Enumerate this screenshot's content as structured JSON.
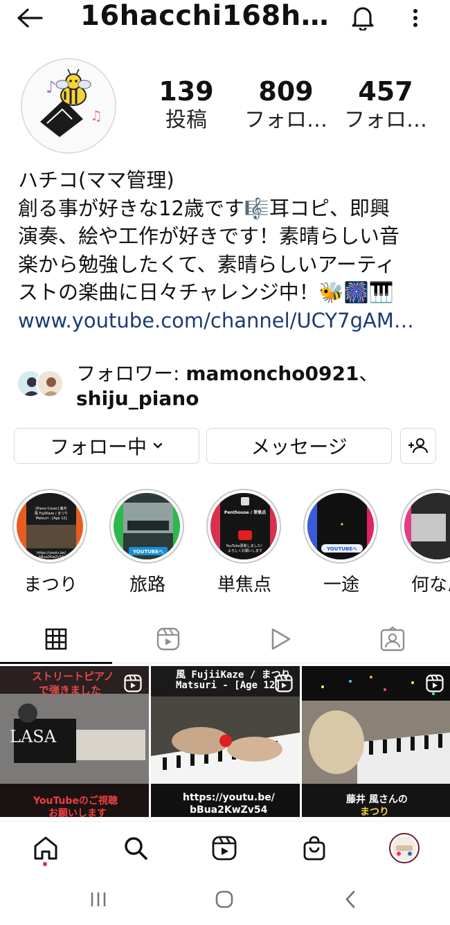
{
  "header": {
    "username": "16hacchi168ha…"
  },
  "stats": [
    {
      "count": "139",
      "label": "投稿"
    },
    {
      "count": "809",
      "label": "フォロ…"
    },
    {
      "count": "457",
      "label": "フォロ…"
    }
  ],
  "bio": {
    "name": "ハチコ(ママ管理)",
    "lines": [
      "創る事が好きな12歳です🎼耳コピ、即興",
      "演奏、絵や工作が好きです！素晴らしい音",
      "楽から勉強したくて、素晴らしいアーティ",
      "ストの楽曲に日々チャレンジ中！🐝🎆🎹"
    ],
    "link": "www.youtube.com/channel/UCY7gAM…"
  },
  "followed_by": {
    "prefix": "フォロワー: ",
    "user1": "mamoncho0921",
    "separator": "、",
    "user2": "shiju_piano"
  },
  "actions": {
    "follow": "フォロー中",
    "message": "メッセージ"
  },
  "highlights": [
    {
      "label": "まつり",
      "card_title": "[Piano Cover] 藤井 風 FujiiKaze / まつり Matsuri - [Age 12]",
      "card_url": "https://youtu.be/ bBua2KwZv54"
    },
    {
      "label": "旅路",
      "card_badge": "YOUTUBEへ"
    },
    {
      "label": "単焦点",
      "card_title": "Penthouse / 単焦点",
      "card_text": "YouTube更新しました！ よろしくお願いします"
    },
    {
      "label": "一途",
      "card_badge": "YOUTUBEへ"
    },
    {
      "label": "何なん"
    }
  ],
  "posts": [
    {
      "top_text": "ストリートピアノ",
      "top_text2": "で弾きました",
      "watermark": "LASA",
      "bottom_text": "YouTubeのご視聴",
      "bottom_text2": "お願いします"
    },
    {
      "top_text": "風 FujiiKaze / まつり",
      "top_text2": "Matsuri - [Age 12]",
      "bottom_text": "https://youtu.be/",
      "bottom_text2": "bBua2KwZv54"
    },
    {
      "bottom_text": "藤井 風さんの",
      "bottom_text2": "まつり"
    }
  ],
  "colors": {
    "link": "#1c3b73",
    "active_dot": "#e0245e"
  }
}
